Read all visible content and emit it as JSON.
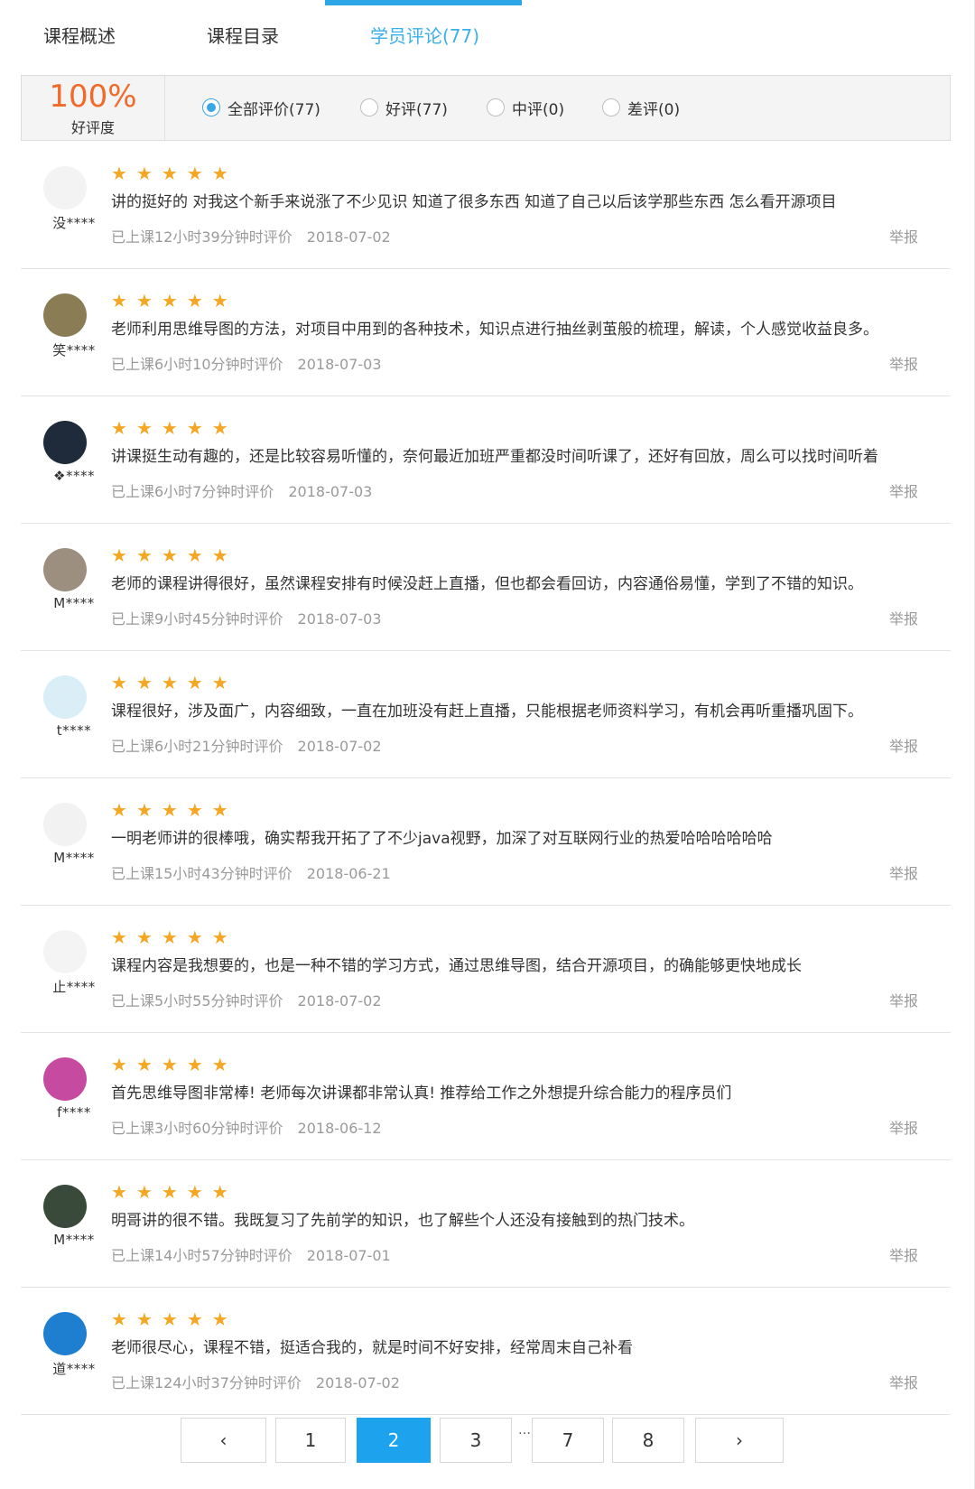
{
  "tabs": [
    {
      "label": "课程概述"
    },
    {
      "label": "课程目录"
    },
    {
      "label": "学员评论(77)"
    }
  ],
  "rating": {
    "percent": "100%",
    "label": "好评度"
  },
  "filters": [
    {
      "label": "全部评价(77)",
      "checked": true
    },
    {
      "label": "好评(77)",
      "checked": false
    },
    {
      "label": "中评(0)",
      "checked": false
    },
    {
      "label": "差评(0)",
      "checked": false
    }
  ],
  "stars": "★",
  "report_label": "举报",
  "reviews": [
    {
      "user": "没****",
      "comment": "讲的挺好的 对我这个新手来说涨了不少见识 知道了很多东西 知道了自己以后该学那些东西 怎么看开源项目",
      "study": "已上课12小时39分钟时评价",
      "date": "2018-07-02",
      "avatar_color": "#f3f3f3"
    },
    {
      "user": "笑****",
      "comment": "老师利用思维导图的方法，对项目中用到的各种技术，知识点进行抽丝剥茧般的梳理，解读，个人感觉收益良多。",
      "study": "已上课6小时10分钟时评价",
      "date": "2018-07-03",
      "avatar_color": "#8a7d55"
    },
    {
      "user": "❖****",
      "comment": "讲课挺生动有趣的，还是比较容易听懂的，奈何最近加班严重都没时间听课了，还好有回放，周么可以找时间听着",
      "study": "已上课6小时7分钟时评价",
      "date": "2018-07-03",
      "avatar_color": "#1f2a3a"
    },
    {
      "user": "M****",
      "comment": "老师的课程讲得很好，虽然课程安排有时候没赶上直播，但也都会看回访，内容通俗易懂，学到了不错的知识。",
      "study": "已上课9小时45分钟时评价",
      "date": "2018-07-03",
      "avatar_color": "#9c8f80"
    },
    {
      "user": "t****",
      "comment": "课程很好，涉及面广，内容细致，一直在加班没有赶上直播，只能根据老师资料学习，有机会再听重播巩固下。",
      "study": "已上课6小时21分钟时评价",
      "date": "2018-07-02",
      "avatar_color": "#d9eef7"
    },
    {
      "user": "M****",
      "comment": "一明老师讲的很棒哦，确实帮我开拓了了不少java视野，加深了对互联网行业的热爱哈哈哈哈哈哈",
      "study": "已上课15小时43分钟时评价",
      "date": "2018-06-21",
      "avatar_color": "#f2f2f2"
    },
    {
      "user": "止****",
      "comment": "课程内容是我想要的，也是一种不错的学习方式，通过思维导图，结合开源项目，的确能够更快地成长",
      "study": "已上课5小时55分钟时评价",
      "date": "2018-07-02",
      "avatar_color": "#f4f4f4"
    },
    {
      "user": "f****",
      "comment": "首先思维导图非常棒! 老师每次讲课都非常认真! 推荐给工作之外想提升综合能力的程序员们",
      "study": "已上课3小时60分钟时评价",
      "date": "2018-06-12",
      "avatar_color": "#c64aa0"
    },
    {
      "user": "M****",
      "comment": "明哥讲的很不错。我既复习了先前学的知识，也了解些个人还没有接触到的热门技术。",
      "study": "已上课14小时57分钟时评价",
      "date": "2018-07-01",
      "avatar_color": "#3a4a3a"
    },
    {
      "user": "道****",
      "comment": "老师很尽心，课程不错，挺适合我的，就是时间不好安排，经常周末自己补看",
      "study": "已上课124小时37分钟时评价",
      "date": "2018-07-02",
      "avatar_color": "#1e7fd0"
    }
  ],
  "pagination": {
    "prev": "‹",
    "next": "›",
    "pages": [
      "1",
      "2",
      "3",
      "7",
      "8"
    ],
    "ellipsis": "…",
    "current": "2"
  }
}
